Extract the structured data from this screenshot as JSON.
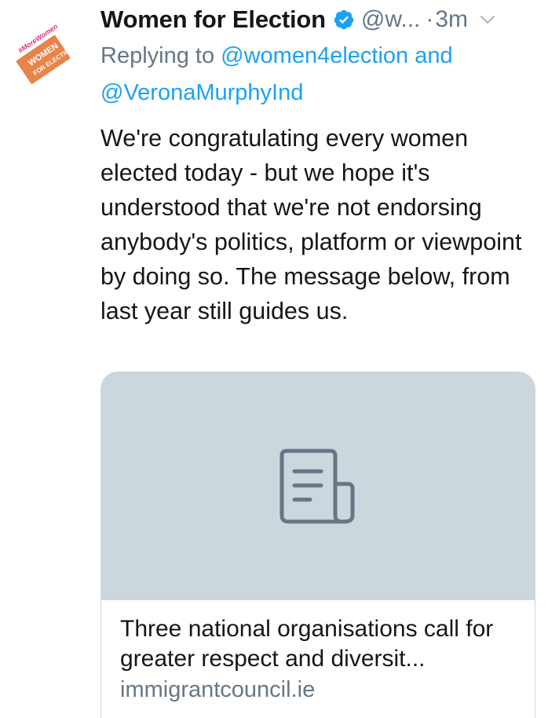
{
  "tweet": {
    "display_name": "Women for Election",
    "handle": "@w...",
    "separator": "·",
    "time": "3m",
    "replying_prefix": "Replying to",
    "reply_mention_1": "@women4election",
    "reply_conjunction": "and",
    "reply_mention_2": "@VeronaMurphyInd",
    "text": "We're congratulating every women elected today - but we hope it's understood that we're not endorsing anybody's politics, platform or viewpoint by doing so. The message below, from last year still guides us."
  },
  "avatar": {
    "logo_tagline": "#MoreWomen",
    "logo_line1": "WOMEN",
    "logo_line2": "FOR ELECTION",
    "logo_color": "#e8834a",
    "tagline_color": "#d6337a"
  },
  "card": {
    "title": "Three national organisations call for greater respect and diversit...",
    "domain": "immigrantcouncil.ie"
  },
  "icons": {
    "verified": "verified-badge-icon",
    "chevron": "chevron-down-icon",
    "card_placeholder": "document-icon"
  },
  "colors": {
    "link": "#1da1f2",
    "secondary": "#657786",
    "text": "#14171a",
    "card_bg": "#ccd6dd"
  }
}
